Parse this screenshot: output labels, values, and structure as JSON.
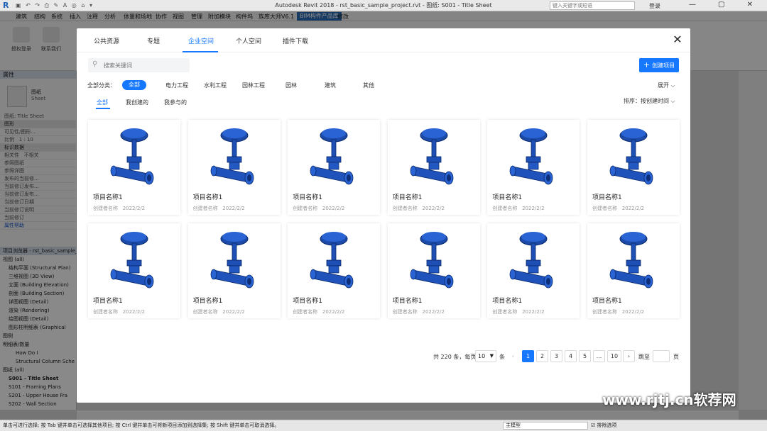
{
  "app": {
    "title": "Autodesk Revit 2018 -    rst_basic_sample_project.rvt - 图纸: S001 - Title Sheet",
    "search_placeholder": "键入关键字或短语",
    "user": "登录",
    "ribbon_tabs": [
      "建筑",
      "结构",
      "系统",
      "插入",
      "注释",
      "分析",
      "体量和场地",
      "协作",
      "视图",
      "管理",
      "附加模块",
      "构件坞",
      "族库大师V6.1",
      "BIM构件产品库",
      "修改"
    ],
    "ribbon_buttons": [
      "授权登录",
      "联系我们"
    ],
    "properties": {
      "header": "属性",
      "type_name": "图纸",
      "type_sub": "Sheet",
      "selector": "图纸: Title Sheet",
      "edit_type": "编辑",
      "rows": [
        "图形",
        "可见性/图形...",
        "比例",
        "标识数据",
        "相关性",
        "参照图纸",
        "参照详图",
        "发布的当前修...",
        "当前修订发布...",
        "当前修订发布...",
        "当前修订日期",
        "当前修订说明",
        "当前修订"
      ],
      "scale_value": "1 : 10",
      "dependency_value": "不相关",
      "edit_label": "编辑...",
      "help": "属性帮助",
      "apply": "应用"
    },
    "browser": {
      "title": "项目浏览器 - rst_basic_sample_project.rvt",
      "items": [
        "视图 (all)",
        "结构平面 (Structural Plan)",
        "三维视图 (3D View)",
        "立面 (Building Elevation)",
        "剖面 (Building Section)",
        "详图视图 (Detail)",
        "渲染 (Rendering)",
        "绘图视图 (Detail)",
        "图形柱明细表 (Graphical",
        "图例",
        "明细表/数量",
        "How Do I",
        "Structural Column Sche",
        "图纸 (all)",
        "S001 - Title Sheet",
        "S101 - Framing Plans",
        "S201 - Upper House Fra",
        "S202 - Wall Section"
      ]
    },
    "statusbar": {
      "text": "单击可进行选择; 按 Tab 键并单击可选择其他项目; 按 Ctrl 键并单击可将新项目添加到选择集; 按 Shift 键并单击可取消选择。",
      "model": "主模型",
      "exclude": "排除选项"
    }
  },
  "modal": {
    "tabs": [
      "公共资源",
      "专题",
      "企业空间",
      "个人空间",
      "插件下载"
    ],
    "active_tab": "企业空间",
    "search_placeholder": "搜索关键词",
    "create_label": "创建项目",
    "category_label": "全部分类：",
    "categories": [
      "全部",
      "电力工程",
      "水利工程",
      "园林工程",
      "园林",
      "建筑",
      "其他"
    ],
    "expand_label": "展开",
    "filters": [
      "全部",
      "我创建的",
      "我参与的"
    ],
    "sort_label": "排序：按创建时间",
    "cards": [
      {
        "name": "项目名称1",
        "creator": "创建者名称",
        "date": "2022/2/2"
      },
      {
        "name": "项目名称1",
        "creator": "创建者名称",
        "date": "2022/2/2"
      },
      {
        "name": "项目名称1",
        "creator": "创建者名称",
        "date": "2022/2/2"
      },
      {
        "name": "项目名称1",
        "creator": "创建者名称",
        "date": "2022/2/2"
      },
      {
        "name": "项目名称1",
        "creator": "创建者名称",
        "date": "2022/2/2"
      },
      {
        "name": "项目名称1",
        "creator": "创建者名称",
        "date": "2022/2/2"
      },
      {
        "name": "项目名称1",
        "creator": "创建者名称",
        "date": "2022/2/2"
      },
      {
        "name": "项目名称1",
        "creator": "创建者名称",
        "date": "2022/2/2"
      },
      {
        "name": "项目名称1",
        "creator": "创建者名称",
        "date": "2022/2/2"
      },
      {
        "name": "项目名称1",
        "creator": "创建者名称",
        "date": "2022/2/2"
      },
      {
        "name": "项目名称1",
        "creator": "创建者名称",
        "date": "2022/2/2"
      },
      {
        "name": "项目名称1",
        "creator": "创建者名称",
        "date": "2022/2/2"
      }
    ],
    "pagination": {
      "total": "共 220 条，每页",
      "page_size": "10",
      "unit": "条",
      "pages": [
        "1",
        "2",
        "3",
        "4",
        "5",
        "...",
        "10"
      ],
      "current": "1",
      "jump": "跳至",
      "page_word": "页"
    }
  },
  "watermark": "www.rjtj.cn软荐网",
  "colors": {
    "accent": "#1677ff",
    "valve_blue": "#1f4fb5"
  }
}
